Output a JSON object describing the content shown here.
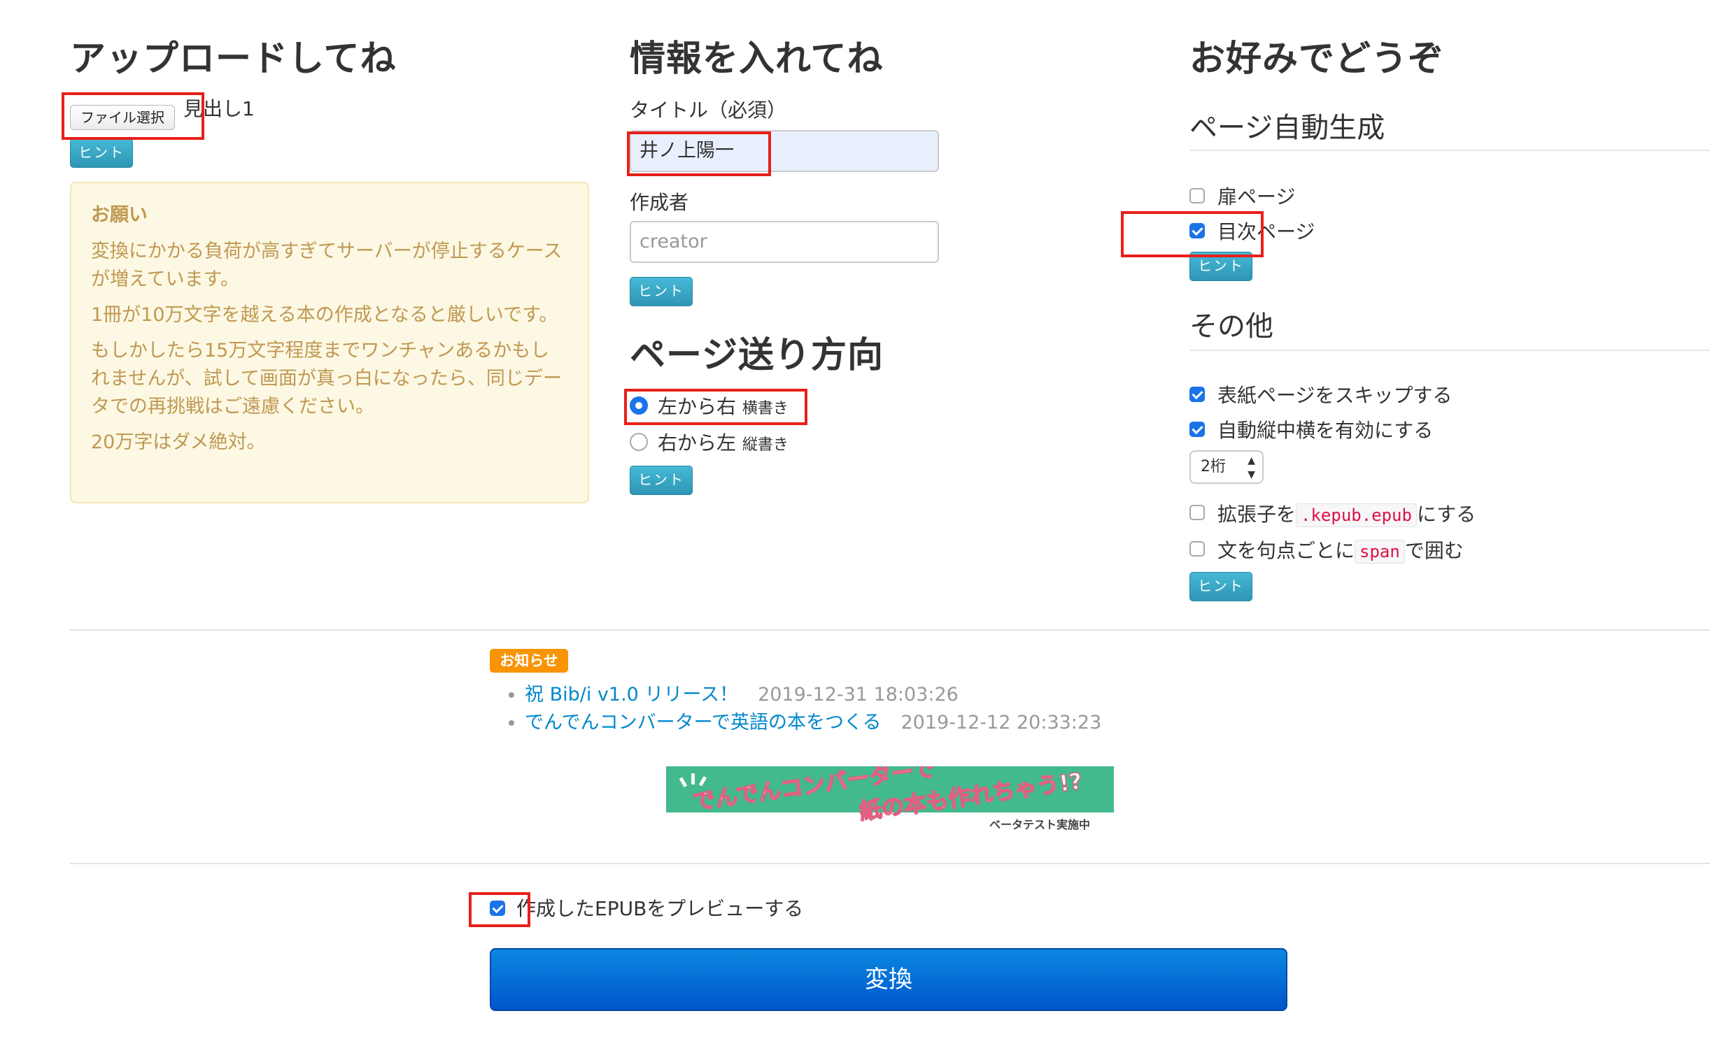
{
  "upload": {
    "heading": "アップロードしてね",
    "file_button": "ファイル選択",
    "file_value": "見出し1",
    "hint": "ヒント",
    "notice": {
      "title": "お願い",
      "paragraphs": [
        "変換にかかる負荷が高すぎてサーバーが停止するケースが増えています。",
        "1冊が10万文字を越える本の作成となると厳しいです。",
        "もしかしたら15万文字程度までワンチャンあるかもしれませんが、試して画面が真っ白になったら、同じデータでの再挑戦はご遠慮ください。",
        "20万字はダメ絶対。"
      ]
    }
  },
  "info": {
    "heading": "情報を入れてね",
    "title_label": "タイトル（必須）",
    "title_value": "井ノ上陽一",
    "creator_label": "作成者",
    "creator_placeholder": "creator",
    "hint": "ヒント"
  },
  "direction": {
    "heading": "ページ送り方向",
    "options": [
      {
        "label": "左から右",
        "sub": "横書き",
        "selected": true
      },
      {
        "label": "右から左",
        "sub": "縦書き",
        "selected": false
      }
    ],
    "hint": "ヒント"
  },
  "prefs": {
    "heading": "お好みでどうぞ",
    "auto_heading": "ページ自動生成",
    "auto_options": [
      {
        "label": "扉ページ",
        "checked": false
      },
      {
        "label": "目次ページ",
        "checked": true
      }
    ],
    "auto_hint": "ヒント",
    "other_heading": "その他",
    "other_options": [
      {
        "label": "表紙ページをスキップする",
        "checked": true
      },
      {
        "label": "自動縦中横を有効にする",
        "checked": true
      }
    ],
    "digits_select": "2桁",
    "ext_option": {
      "before": "拡張子を",
      "code": ".kepub.epub",
      "after": "にする",
      "checked": false
    },
    "span_option": {
      "before": "文を句点ごとに",
      "code": "span",
      "after": "で囲む",
      "checked": false
    },
    "other_hint": "ヒント"
  },
  "news": {
    "badge": "お知らせ",
    "items": [
      {
        "title": "祝 Bib/i v1.0 リリース！",
        "date": "2019-12-31 18:03:26"
      },
      {
        "title": "でんでんコンバーターで英語の本をつくる",
        "date": "2019-12-12 20:33:23"
      }
    ]
  },
  "banner": {
    "line1": "でんでんコンバーターで",
    "line2": "紙の本も作れちゃう!?",
    "line3": "ベータテスト実施中"
  },
  "footer": {
    "preview_label": "作成したEPUBをプレビューする",
    "preview_checked": true,
    "convert_button": "変換"
  },
  "colors": {
    "accent": "#1a73e8",
    "hint_button": "#2f96b4",
    "highlight_box": "#e8201a",
    "badge": "#f89406"
  }
}
